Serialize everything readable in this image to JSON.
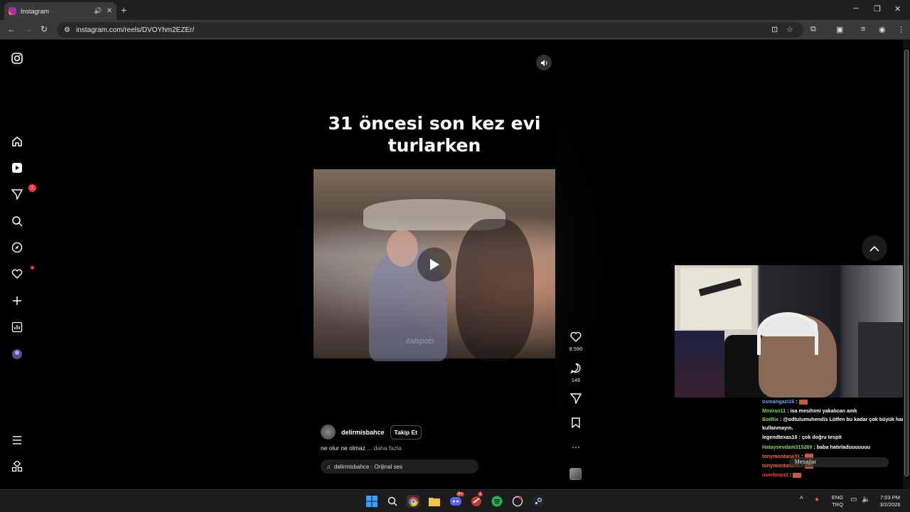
{
  "browser": {
    "tab_title": "Instagram",
    "url": "instagram.com/reels/DVOYhm2EZEr/",
    "new_tab": "+",
    "tab_close": "✕"
  },
  "sidebar": {
    "notification_count": "1",
    "items": [
      "instagram-logo",
      "home",
      "reels",
      "messages",
      "search",
      "explore",
      "notifications",
      "create",
      "dashboard",
      "profile",
      "more",
      "also-from-meta"
    ]
  },
  "reel": {
    "caption": "31 öncesi son kez evi turlarken",
    "username": "delirmisbahce",
    "follow_label": "Takip Et",
    "description": "ne olur ne olmaz",
    "more_label": "... daha fazla",
    "audio": "delirmisbahce · Orijinal ses",
    "watermark": "italspots"
  },
  "actions": {
    "likes": "8.590",
    "comments": "146"
  },
  "chat": {
    "messages": [
      {
        "user": "osmangazi16",
        "text": "",
        "color": "#6aa6ff",
        "emote": true
      },
      {
        "user": "Mmiran11",
        "text": "isa mesihimi yakalıcan amk",
        "color": "#7ed957",
        "emote": false
      },
      {
        "user": "BotRix",
        "text": "@odtulumuhendis Lütfen bu kadar çok büyük harf kullanmayın.",
        "color": "#7ed957",
        "emote": false
      },
      {
        "user": "legendtexas16",
        "text": "çok doğru tespit",
        "color": "#ffffff",
        "emote": false
      },
      {
        "user": "Hataysevdam315269",
        "text": "baba hatırladuuuuuuu",
        "color": "#7ed957",
        "emote": false
      },
      {
        "user": "tonymontana31",
        "text": "",
        "color": "#ff6a3d",
        "emote": true
      },
      {
        "user": "tonymontana31",
        "text": "",
        "color": "#ff6a3d",
        "emote": true
      },
      {
        "user": "userbequit",
        "text": "",
        "color": "#ff3b3b",
        "emote": true
      }
    ],
    "input_placeholder": "Mesajlar"
  },
  "taskbar": {
    "lang_top": "ENG",
    "lang_bottom": "TRQ",
    "time": "7:03 PM",
    "date": "3/2/2026",
    "discord_badge": "9+",
    "app_badge": "1"
  }
}
